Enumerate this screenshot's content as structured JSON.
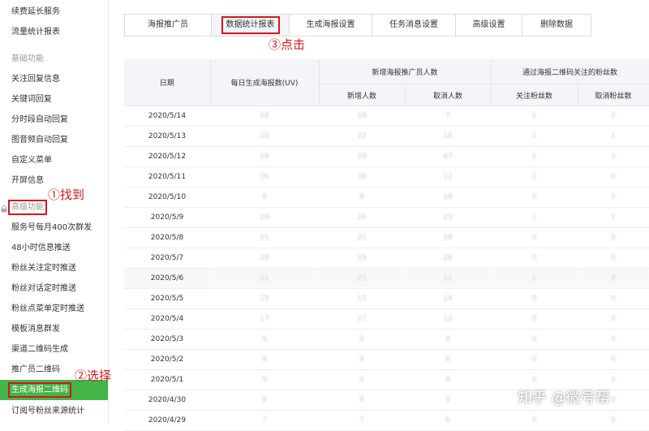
{
  "sidebar": {
    "items": [
      {
        "label": "续费延长服务",
        "type": "item"
      },
      {
        "label": "流量统计报表",
        "type": "item"
      },
      {
        "label": "基础功能",
        "type": "section"
      },
      {
        "label": "关注回复信息",
        "type": "item"
      },
      {
        "label": "关键词回复",
        "type": "item"
      },
      {
        "label": "分时段自动回复",
        "type": "item"
      },
      {
        "label": "图音频自动回复",
        "type": "item"
      },
      {
        "label": "自定义菜单",
        "type": "item"
      },
      {
        "label": "开屏信息",
        "type": "item"
      },
      {
        "label": "高级功能",
        "type": "section"
      },
      {
        "label": "服务号每月400次群发",
        "type": "item"
      },
      {
        "label": "48小时信息推送",
        "type": "item"
      },
      {
        "label": "粉丝关注定时推送",
        "type": "item"
      },
      {
        "label": "粉丝对话定时推送",
        "type": "item"
      },
      {
        "label": "粉丝点菜单定时推送",
        "type": "item"
      },
      {
        "label": "模板消息群发",
        "type": "item"
      },
      {
        "label": "渠道二维码生成",
        "type": "item"
      },
      {
        "label": "推广员二维码",
        "type": "item"
      },
      {
        "label": "生成海报二维码",
        "type": "item",
        "active": true
      },
      {
        "label": "订阅号粉丝来源统计",
        "type": "item"
      }
    ]
  },
  "annotations": {
    "find": "①找到",
    "select": "②选择",
    "click": "③点击"
  },
  "tabs": [
    {
      "label": "海报推广员"
    },
    {
      "label": "数据统计报表",
      "active": true
    },
    {
      "label": "生成海报设置"
    },
    {
      "label": "任务消息设置"
    },
    {
      "label": "高级设置"
    },
    {
      "label": "删除数据"
    }
  ],
  "table": {
    "headers": {
      "date": "日期",
      "daily": "每日生成海报数(UV)",
      "group1": "新增海报推广员人数",
      "group1_new": "新增人数",
      "group1_cancel": "取消人数",
      "group2": "通过海报二维码关注的粉丝数",
      "group2_follow": "关注粉丝数",
      "group2_cancel": "取消粉丝数"
    },
    "rows": [
      {
        "date": "2020/5/14",
        "v": [
          "18",
          "18",
          "7",
          "1",
          "2"
        ]
      },
      {
        "date": "2020/5/13",
        "v": [
          "20",
          "22",
          "18",
          "1",
          "1"
        ]
      },
      {
        "date": "2020/5/12",
        "v": [
          "28",
          "29",
          "47",
          "2",
          "3"
        ]
      },
      {
        "date": "2020/5/11",
        "v": [
          "36",
          "36",
          "12",
          "2",
          "0"
        ]
      },
      {
        "date": "2020/5/10",
        "v": [
          "9",
          "9",
          "18",
          "0",
          "0"
        ]
      },
      {
        "date": "2020/5/9",
        "v": [
          "29",
          "20",
          "23",
          "1",
          "1"
        ]
      },
      {
        "date": "2020/5/8",
        "v": [
          "21",
          "21",
          "28",
          "0",
          "0"
        ]
      },
      {
        "date": "2020/5/7",
        "v": [
          "28",
          "29",
          "28",
          "0",
          "0"
        ]
      },
      {
        "date": "2020/5/6",
        "v": [
          "21",
          "21",
          "11",
          "1",
          "0"
        ]
      },
      {
        "date": "2020/5/5",
        "v": [
          "15",
          "15",
          "14",
          "0",
          "0"
        ]
      },
      {
        "date": "2020/5/4",
        "v": [
          "17",
          "17",
          "12",
          "0",
          "0"
        ]
      },
      {
        "date": "2020/5/3",
        "v": [
          "9",
          "9",
          "8",
          "0",
          "0"
        ]
      },
      {
        "date": "2020/5/2",
        "v": [
          "9",
          "9",
          "6",
          "0",
          "0"
        ]
      },
      {
        "date": "2020/5/1",
        "v": [
          "9",
          "9",
          "8",
          "0",
          "0"
        ]
      },
      {
        "date": "2020/4/30",
        "v": [
          "8",
          "8",
          "9",
          "0",
          "0"
        ]
      },
      {
        "date": "2020/4/29",
        "v": [
          "7",
          "7",
          "6",
          "0",
          "0"
        ]
      }
    ]
  },
  "watermark": "知乎 @微号帮",
  "colors": {
    "active_green": "#44b549",
    "annotation_red": "#d9151b",
    "header_bg": "#f4f5f9"
  }
}
